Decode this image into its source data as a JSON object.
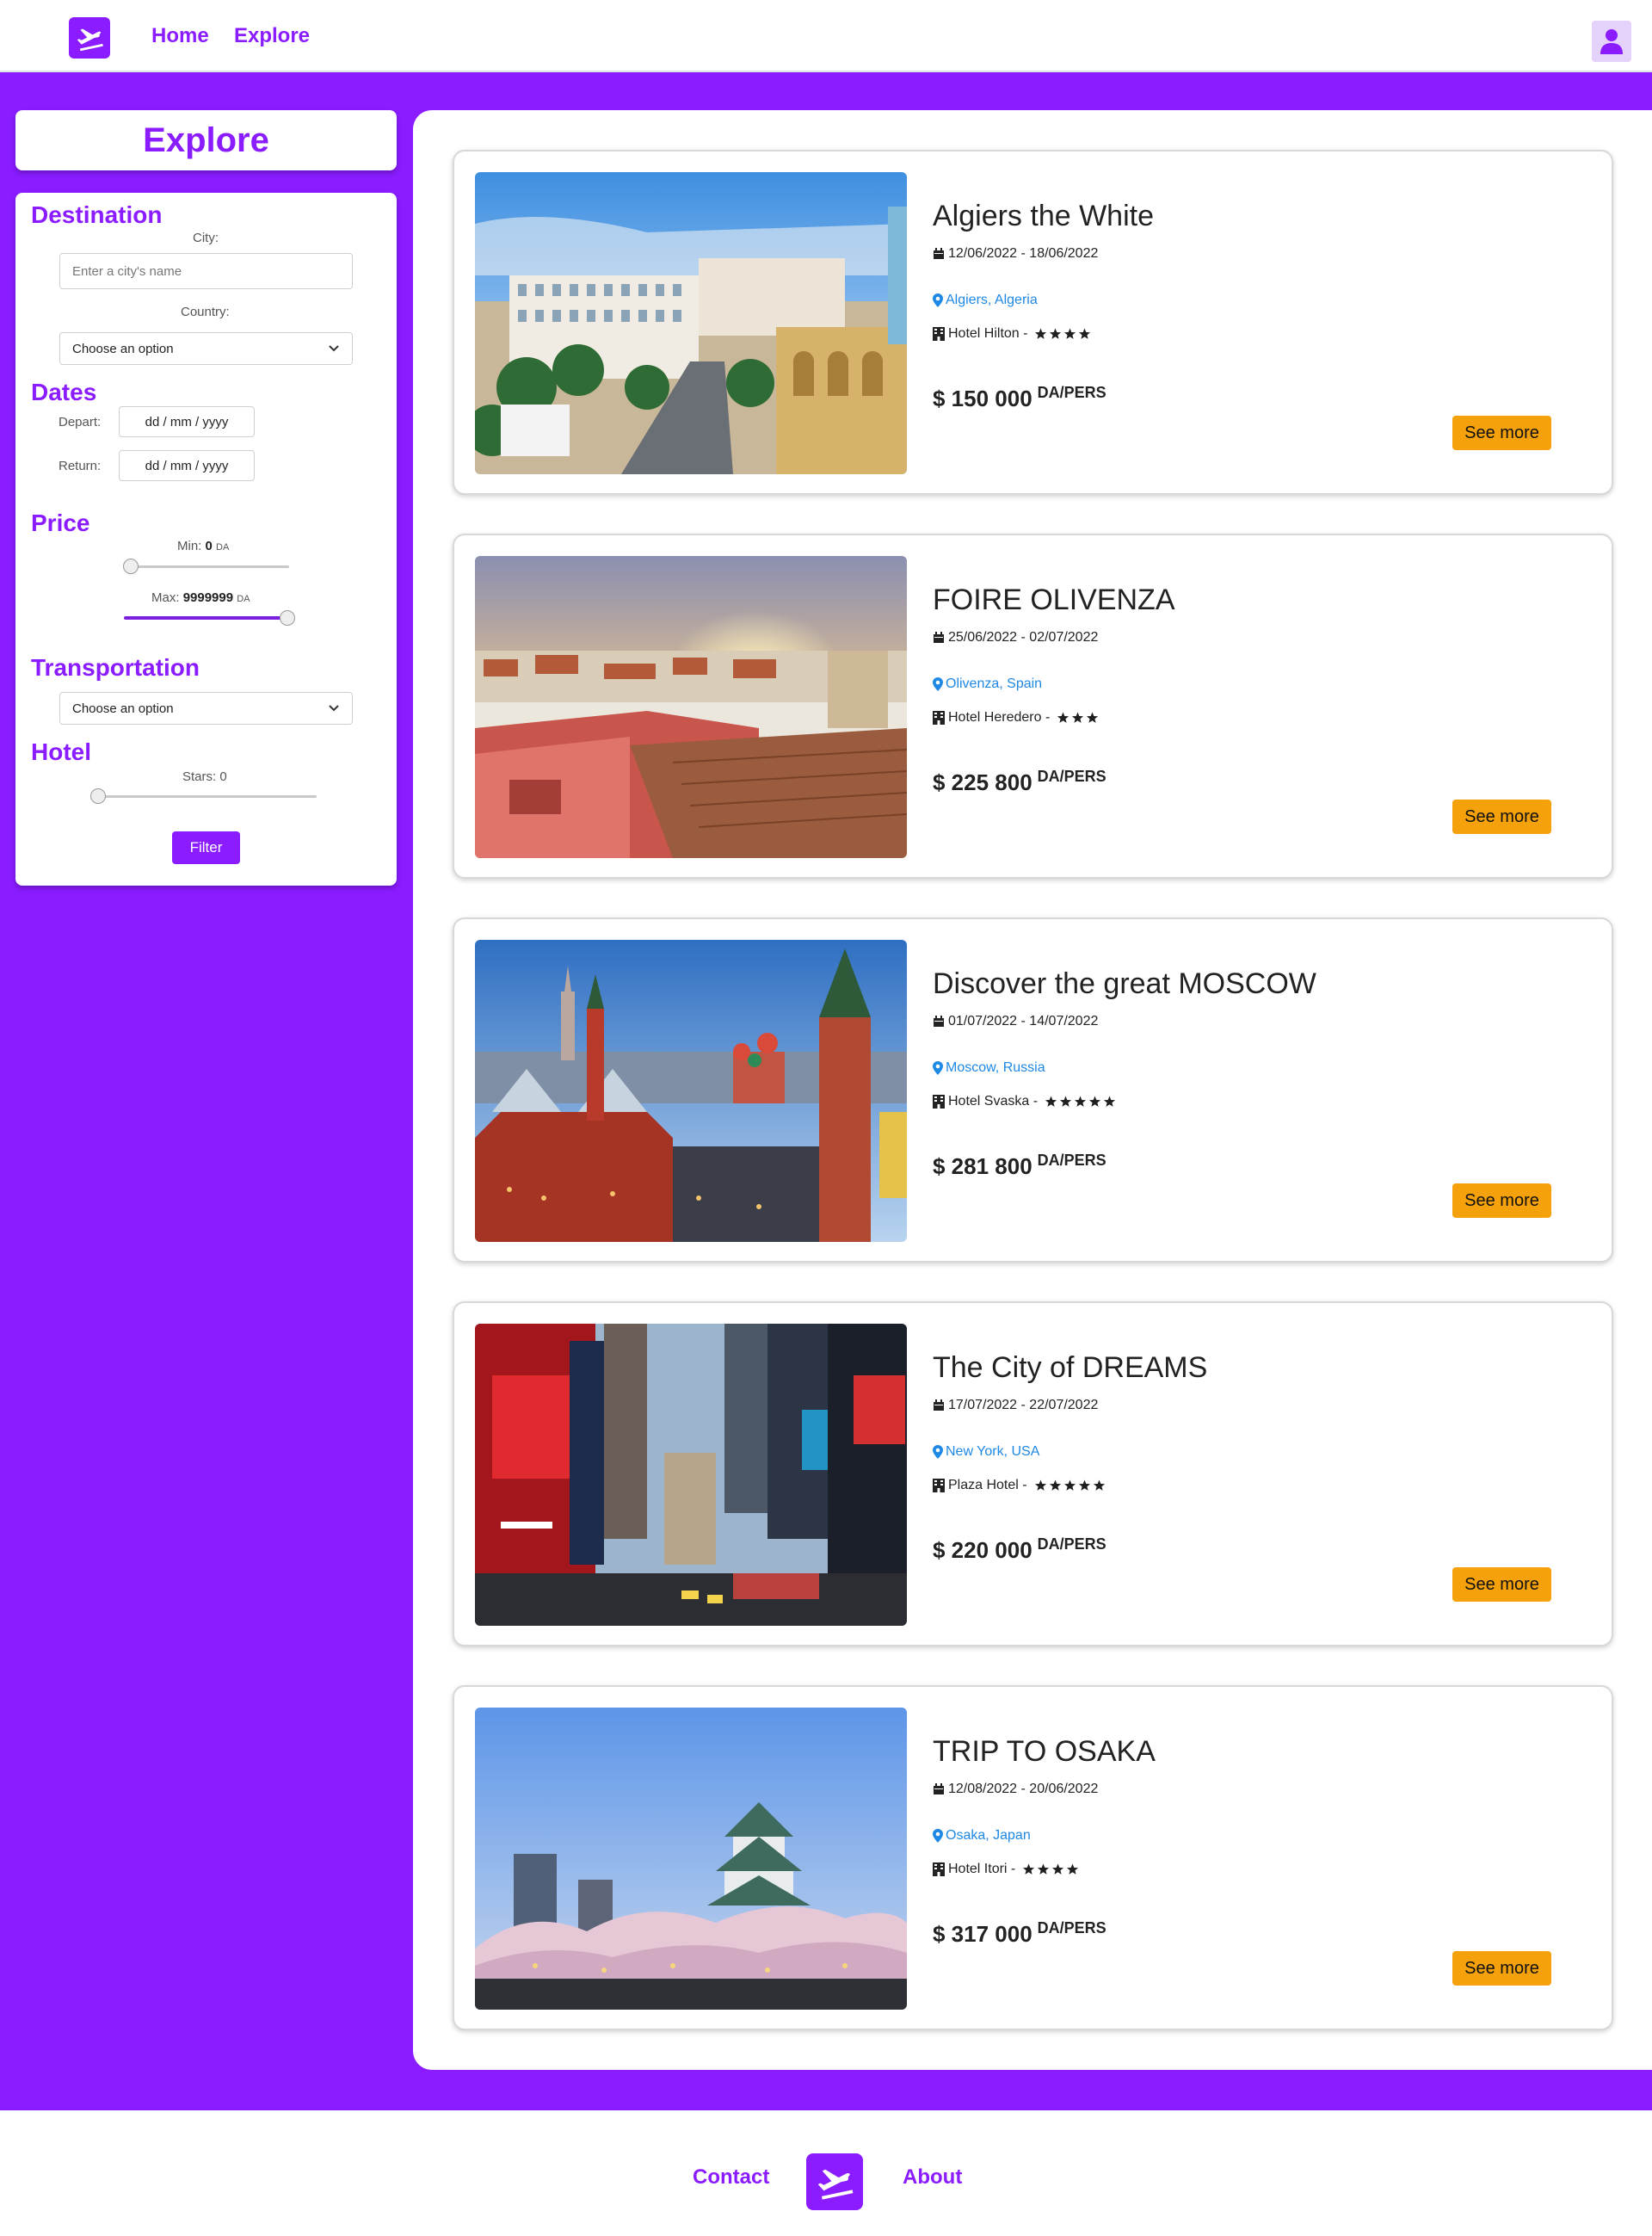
{
  "header": {
    "logo_icon": "airplane-icon",
    "nav": [
      {
        "label": "Home"
      },
      {
        "label": "Explore"
      }
    ],
    "user_icon": "user-icon"
  },
  "sidebar": {
    "title": "Explore",
    "destination": {
      "title": "Destination",
      "city_label": "City:",
      "city_placeholder": "Enter a city's name",
      "country_label": "Country:",
      "country_value": "Choose an option"
    },
    "dates": {
      "title": "Dates",
      "depart_label": "Depart:",
      "depart_value": "dd / mm / yyyy",
      "return_label": "Return:",
      "return_value": "dd / mm / yyyy"
    },
    "price": {
      "title": "Price",
      "min_label": "Min:",
      "min_value": "0",
      "max_label": "Max:",
      "max_value": "9999999",
      "currency": "DA",
      "min_fraction": 0,
      "max_fraction": 1
    },
    "transportation": {
      "title": "Transportation",
      "value": "Choose an option"
    },
    "hotel": {
      "title": "Hotel",
      "stars_label": "Stars:",
      "stars_value": "0",
      "stars_fraction": 0
    },
    "filter_button": "Filter"
  },
  "trips": [
    {
      "title": "Algiers the White",
      "dates": "12/06/2022 - 18/06/2022",
      "location": "Algiers, Algeria",
      "hotel": "Hotel Hilton -",
      "stars": 4,
      "price": "$ 150 000",
      "price_unit": "DA/PERS",
      "button": "See more"
    },
    {
      "title": "FOIRE OLIVENZA",
      "dates": "25/06/2022 - 02/07/2022",
      "location": "Olivenza, Spain",
      "hotel": "Hotel Heredero -",
      "stars": 3,
      "price": "$ 225 800",
      "price_unit": "DA/PERS",
      "button": "See more"
    },
    {
      "title": "Discover the great MOSCOW",
      "dates": "01/07/2022 - 14/07/2022",
      "location": "Moscow, Russia",
      "hotel": "Hotel Svaska -",
      "stars": 5,
      "price": "$ 281 800",
      "price_unit": "DA/PERS",
      "button": "See more"
    },
    {
      "title": "The City of DREAMS",
      "dates": "17/07/2022 - 22/07/2022",
      "location": "New York, USA",
      "hotel": "Plaza Hotel -",
      "stars": 5,
      "price": "$ 220 000",
      "price_unit": "DA/PERS",
      "button": "See more"
    },
    {
      "title": "TRIP TO OSAKA",
      "dates": "12/08/2022 - 20/06/2022",
      "location": "Osaka, Japan",
      "hotel": "Hotel Itori -",
      "stars": 4,
      "price": "$ 317 000",
      "price_unit": "DA/PERS",
      "button": "See more"
    }
  ],
  "footer": {
    "contact": "Contact",
    "about": "About"
  },
  "colors": {
    "brand": "#8a1cff",
    "button_accent": "#f5a10b",
    "link": "#1e88e5"
  }
}
